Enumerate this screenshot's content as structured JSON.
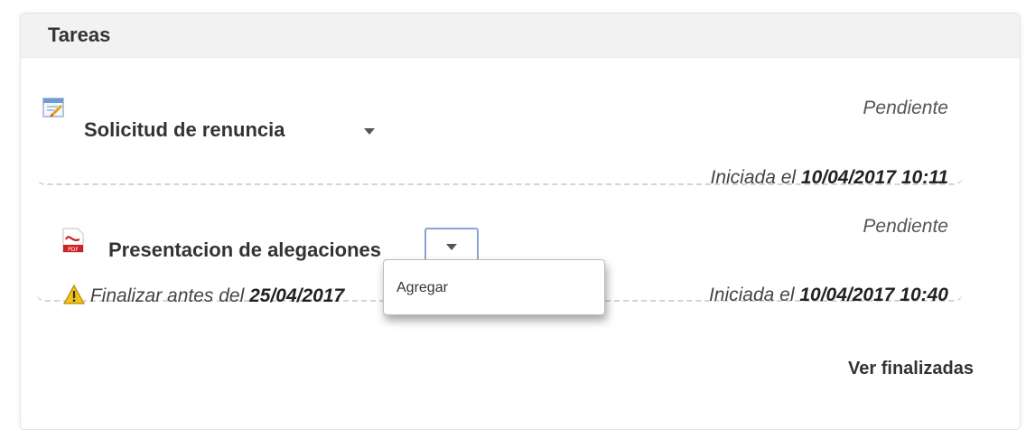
{
  "panel": {
    "title": "Tareas"
  },
  "tasks": [
    {
      "title": "Solicitud de renuncia",
      "status": "Pendiente",
      "started_label": "Iniciada el",
      "started_value": "10/04/2017 10:11",
      "icon": "form-edit-icon"
    },
    {
      "title": "Presentacion de alegaciones",
      "status": "Pendiente",
      "started_label": "Iniciada el",
      "started_value": "10/04/2017 10:40",
      "deadline_label": "Finalizar antes del",
      "deadline_value": "25/04/2017",
      "icon": "pdf-icon",
      "warning_icon": "warning-icon"
    }
  ],
  "dropdown": {
    "items": [
      "Agregar"
    ]
  },
  "footer": {
    "link_label": "Ver finalizadas"
  }
}
